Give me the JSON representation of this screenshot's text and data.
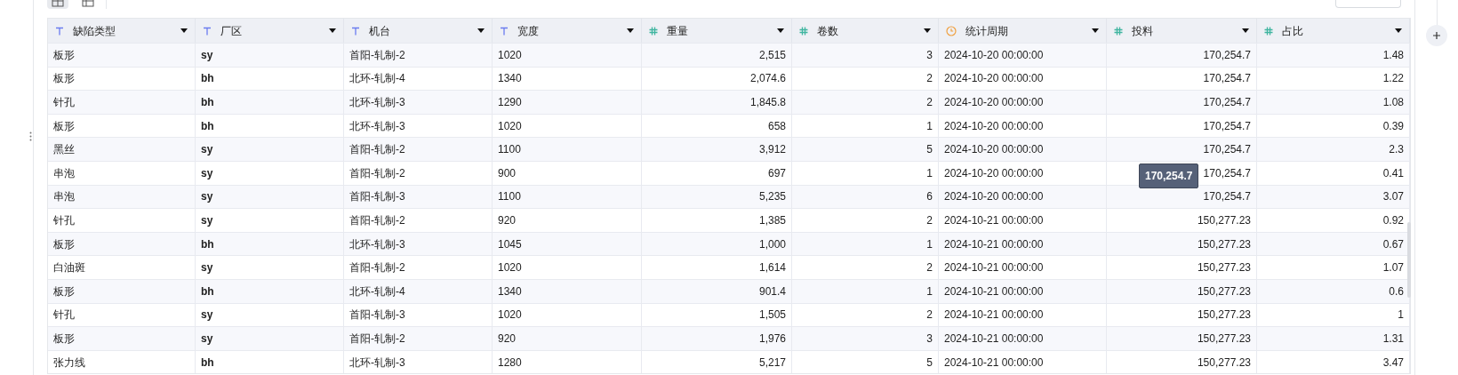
{
  "view_toggles": [
    {
      "kind": "grid",
      "selected": true
    },
    {
      "kind": "columns",
      "selected": false
    }
  ],
  "table": {
    "columns": [
      {
        "label": "缺陷类型",
        "kind": "text"
      },
      {
        "label": "厂区",
        "kind": "text"
      },
      {
        "label": "机台",
        "kind": "text"
      },
      {
        "label": "宽度",
        "kind": "text"
      },
      {
        "label": "重量",
        "kind": "number"
      },
      {
        "label": "卷数",
        "kind": "number"
      },
      {
        "label": "统计周期",
        "kind": "date"
      },
      {
        "label": "投料",
        "kind": "number"
      },
      {
        "label": "占比",
        "kind": "number"
      }
    ],
    "rows": [
      [
        "板形",
        "sy",
        "首阳-轧制-2",
        "1020",
        "2,515",
        "3",
        "2024-10-20 00:00:00",
        "170,254.7",
        "1.48"
      ],
      [
        "板形",
        "bh",
        "北环-轧制-4",
        "1340",
        "2,074.6",
        "2",
        "2024-10-20 00:00:00",
        "170,254.7",
        "1.22"
      ],
      [
        "针孔",
        "bh",
        "北环-轧制-3",
        "1290",
        "1,845.8",
        "2",
        "2024-10-20 00:00:00",
        "170,254.7",
        "1.08"
      ],
      [
        "板形",
        "bh",
        "北环-轧制-3",
        "1020",
        "658",
        "1",
        "2024-10-20 00:00:00",
        "170,254.7",
        "0.39"
      ],
      [
        "黑丝",
        "sy",
        "首阳-轧制-2",
        "1100",
        "3,912",
        "5",
        "2024-10-20 00:00:00",
        "170,254.7",
        "2.3"
      ],
      [
        "串泡",
        "sy",
        "首阳-轧制-2",
        "900",
        "697",
        "1",
        "2024-10-20 00:00:00",
        "170,254.7",
        "0.41"
      ],
      [
        "串泡",
        "sy",
        "首阳-轧制-3",
        "1100",
        "5,235",
        "6",
        "2024-10-20 00:00:00",
        "170,254.7",
        "3.07"
      ],
      [
        "针孔",
        "sy",
        "首阳-轧制-2",
        "920",
        "1,385",
        "2",
        "2024-10-21 00:00:00",
        "150,277.23",
        "0.92"
      ],
      [
        "板形",
        "bh",
        "北环-轧制-3",
        "1045",
        "1,000",
        "1",
        "2024-10-21 00:00:00",
        "150,277.23",
        "0.67"
      ],
      [
        "白油斑",
        "sy",
        "首阳-轧制-2",
        "1020",
        "1,614",
        "2",
        "2024-10-21 00:00:00",
        "150,277.23",
        "1.07"
      ],
      [
        "板形",
        "bh",
        "北环-轧制-4",
        "1340",
        "901.4",
        "1",
        "2024-10-21 00:00:00",
        "150,277.23",
        "0.6"
      ],
      [
        "针孔",
        "sy",
        "首阳-轧制-3",
        "1020",
        "1,505",
        "2",
        "2024-10-21 00:00:00",
        "150,277.23",
        "1"
      ],
      [
        "板形",
        "sy",
        "首阳-轧制-2",
        "920",
        "1,976",
        "3",
        "2024-10-21 00:00:00",
        "150,277.23",
        "1.31"
      ],
      [
        "张力线",
        "bh",
        "北环-轧制-3",
        "1280",
        "5,217",
        "5",
        "2024-10-21 00:00:00",
        "150,277.23",
        "3.47"
      ]
    ]
  },
  "tooltip": {
    "text": "170,254.7"
  }
}
